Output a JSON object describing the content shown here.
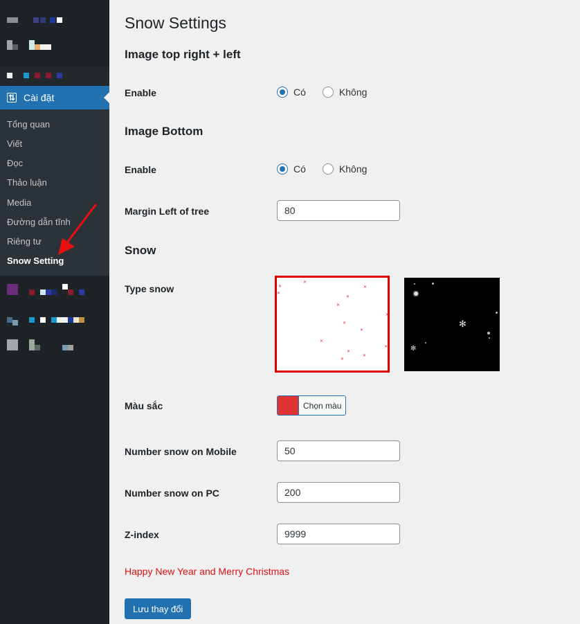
{
  "sidebar": {
    "active_menu": {
      "label": "Cài đặt",
      "icon": "settings-sliders-icon"
    },
    "submenu": [
      {
        "label": "Tổng quan"
      },
      {
        "label": "Viết"
      },
      {
        "label": "Đọc"
      },
      {
        "label": "Thảo luận"
      },
      {
        "label": "Media"
      },
      {
        "label": "Đường dẫn tĩnh"
      },
      {
        "label": "Riêng tư"
      },
      {
        "label": "Snow Setting"
      }
    ],
    "colors": {
      "bg": "#1d2327",
      "submenu_bg": "#2c3338",
      "active": "#2271b1"
    }
  },
  "page": {
    "title": "Snow Settings",
    "sections": {
      "top": {
        "title": "Image top right + left",
        "enable_label": "Enable"
      },
      "bottom": {
        "title": "Image Bottom",
        "enable_label": "Enable",
        "margin_label": "Margin Left of tree",
        "margin_value": "80"
      },
      "snow": {
        "title": "Snow",
        "type_label": "Type snow"
      }
    },
    "radio": {
      "yes": "Có",
      "no": "Không"
    },
    "color": {
      "label": "Màu sắc",
      "button": "Chọn màu",
      "value": "#dd3333"
    },
    "mobile": {
      "label": "Number snow on Mobile",
      "value": "50"
    },
    "pc": {
      "label": "Number snow on PC",
      "value": "200"
    },
    "zindex": {
      "label": "Z-index",
      "value": "9999"
    },
    "greeting": "Happy New Year and Merry Christmas",
    "save": "Lưu thay đổi"
  }
}
